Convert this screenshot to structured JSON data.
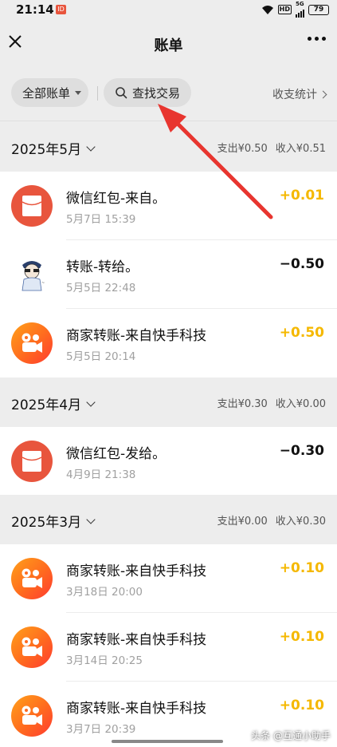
{
  "status_bar": {
    "time": "21:14",
    "notification_badge": "ID",
    "hd_label": "HD",
    "network_label": "5G",
    "battery": "79"
  },
  "nav": {
    "title": "账单",
    "close_icon": "close-icon",
    "more_icon": "more-icon"
  },
  "filters": {
    "all_bills": "全部账单",
    "search": "查找交易",
    "stats": "收支统计"
  },
  "colors": {
    "income": "#f5b800",
    "expense": "#111111",
    "hongbao_red": "#e8553d",
    "arrow_red": "#e8352f"
  },
  "sections": [
    {
      "month": "2025年5月",
      "expense": "支出¥0.50",
      "income": "收入¥0.51",
      "transactions": [
        {
          "title": "微信红包-来自。",
          "time": "5月7日 15:39",
          "amount": "+0.01",
          "type": "income",
          "icon": "red-envelope-icon"
        },
        {
          "title": "转账-转给。",
          "time": "5月5日 22:48",
          "amount": "−0.50",
          "type": "expense",
          "icon": "user-avatar"
        },
        {
          "title": "商家转账-来自快手科技",
          "time": "5月5日 20:14",
          "amount": "+0.50",
          "type": "income",
          "icon": "kuaishou-logo-icon"
        }
      ]
    },
    {
      "month": "2025年4月",
      "expense": "支出¥0.30",
      "income": "收入¥0.00",
      "transactions": [
        {
          "title": "微信红包-发给。",
          "time": "4月9日 21:38",
          "amount": "−0.30",
          "type": "expense",
          "icon": "red-envelope-icon"
        }
      ]
    },
    {
      "month": "2025年3月",
      "expense": "支出¥0.00",
      "income": "收入¥0.30",
      "transactions": [
        {
          "title": "商家转账-来自快手科技",
          "time": "3月18日 20:00",
          "amount": "+0.10",
          "type": "income",
          "icon": "kuaishou-logo-icon"
        },
        {
          "title": "商家转账-来自快手科技",
          "time": "3月14日 20:25",
          "amount": "+0.10",
          "type": "income",
          "icon": "kuaishou-logo-icon"
        },
        {
          "title": "商家转账-来自快手科技",
          "time": "3月7日 20:39",
          "amount": "+0.10",
          "type": "income",
          "icon": "kuaishou-logo-icon"
        }
      ]
    }
  ],
  "watermark": "头条 @互通小助手"
}
